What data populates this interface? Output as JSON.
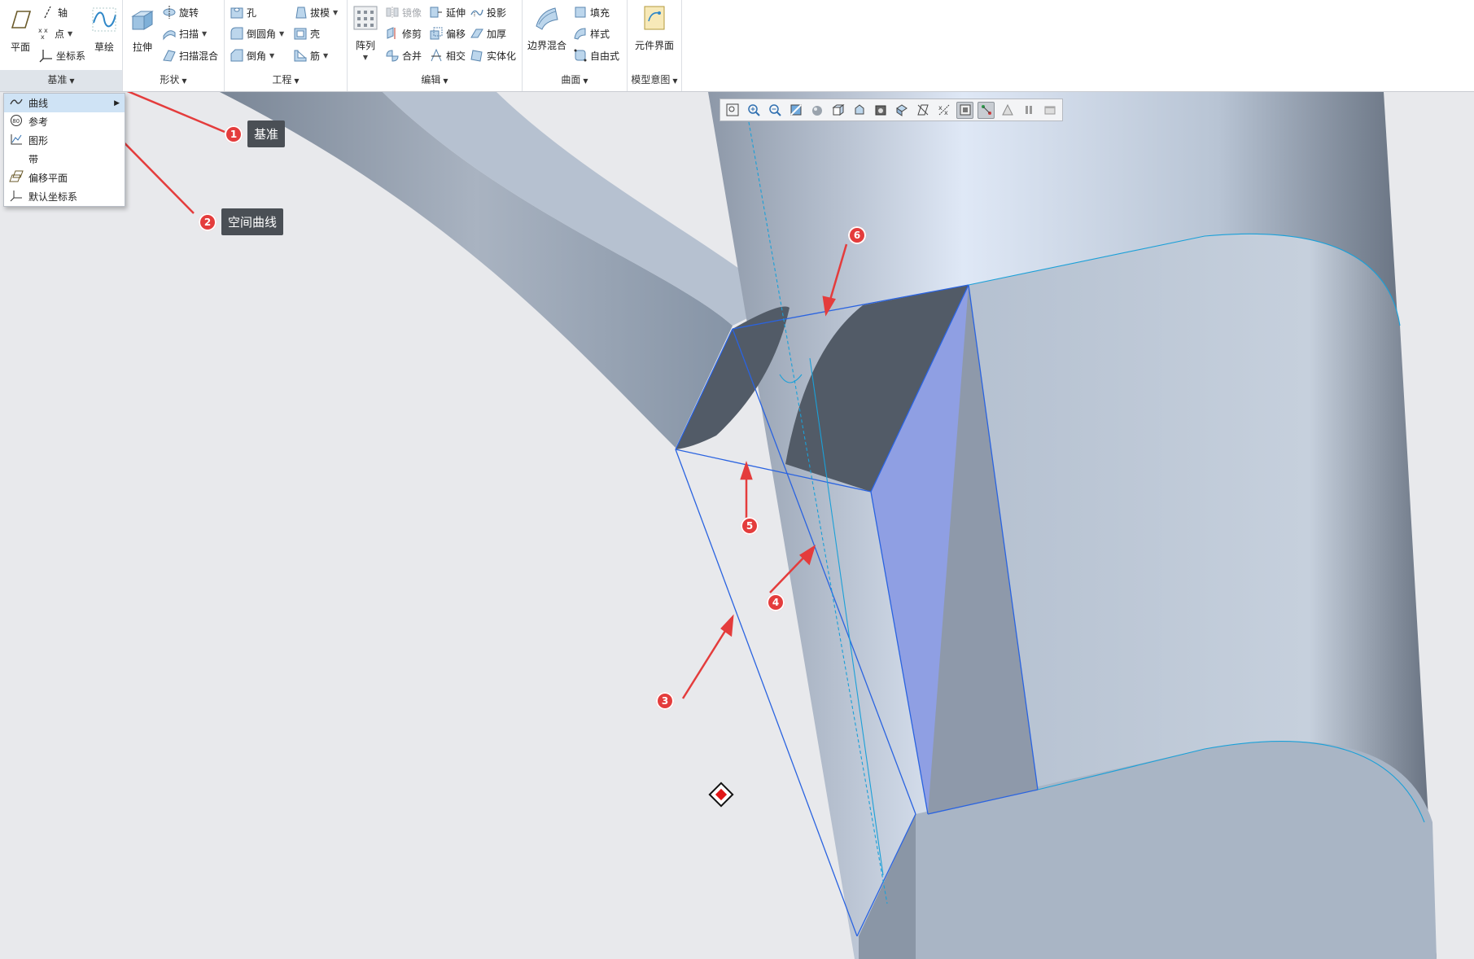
{
  "ribbon": {
    "datum": {
      "label": "基准",
      "plane": "平面",
      "axis": "轴",
      "point": "点",
      "csys": "坐标系",
      "sketch": "草绘"
    },
    "shapes": {
      "label": "形状",
      "extrude": "拉伸",
      "revolve": "旋转",
      "sweep": "扫描",
      "swept_blend": "扫描混合"
    },
    "engineering": {
      "label": "工程",
      "hole": "孔",
      "round": "倒圆角",
      "chamfer": "倒角",
      "draft": "拔模",
      "shell": "壳",
      "rib": "筋"
    },
    "editing": {
      "label": "编辑",
      "pattern": "阵列",
      "mirror": "镜像",
      "trim": "修剪",
      "merge": "合并",
      "extend": "延伸",
      "offset": "偏移",
      "intersect": "相交",
      "project": "投影",
      "thicken": "加厚",
      "solidify": "实体化"
    },
    "surfaces": {
      "label": "曲面",
      "boundary_blend": "边界混合",
      "fill": "填充",
      "style": "样式",
      "freestyle": "自由式"
    },
    "model_intent": {
      "label": "模型意图",
      "component_interface": "元件界面"
    }
  },
  "datum_menu": {
    "items": [
      {
        "label": "曲线",
        "icon": "curve-icon"
      },
      {
        "label": "参考",
        "icon": "reference-icon"
      },
      {
        "label": "图形",
        "icon": "graph-icon"
      },
      {
        "label": "带",
        "icon": "ribbon-icon"
      },
      {
        "label": "偏移平面",
        "icon": "offset-plane-icon"
      },
      {
        "label": "默认坐标系",
        "icon": "default-csys-icon"
      }
    ]
  },
  "annotations": [
    {
      "num": "1",
      "text": "基准"
    },
    {
      "num": "2",
      "text": "空间曲线"
    },
    {
      "num": "3",
      "text": ""
    },
    {
      "num": "4",
      "text": ""
    },
    {
      "num": "5",
      "text": ""
    },
    {
      "num": "6",
      "text": ""
    }
  ],
  "colors": {
    "accent_red": "#e43c3c",
    "edge_blue": "#2a63e0",
    "curve_cyan": "#1aa0d8",
    "model_gray": "#8b96a5",
    "highlight_face": "#8f9fe3"
  }
}
